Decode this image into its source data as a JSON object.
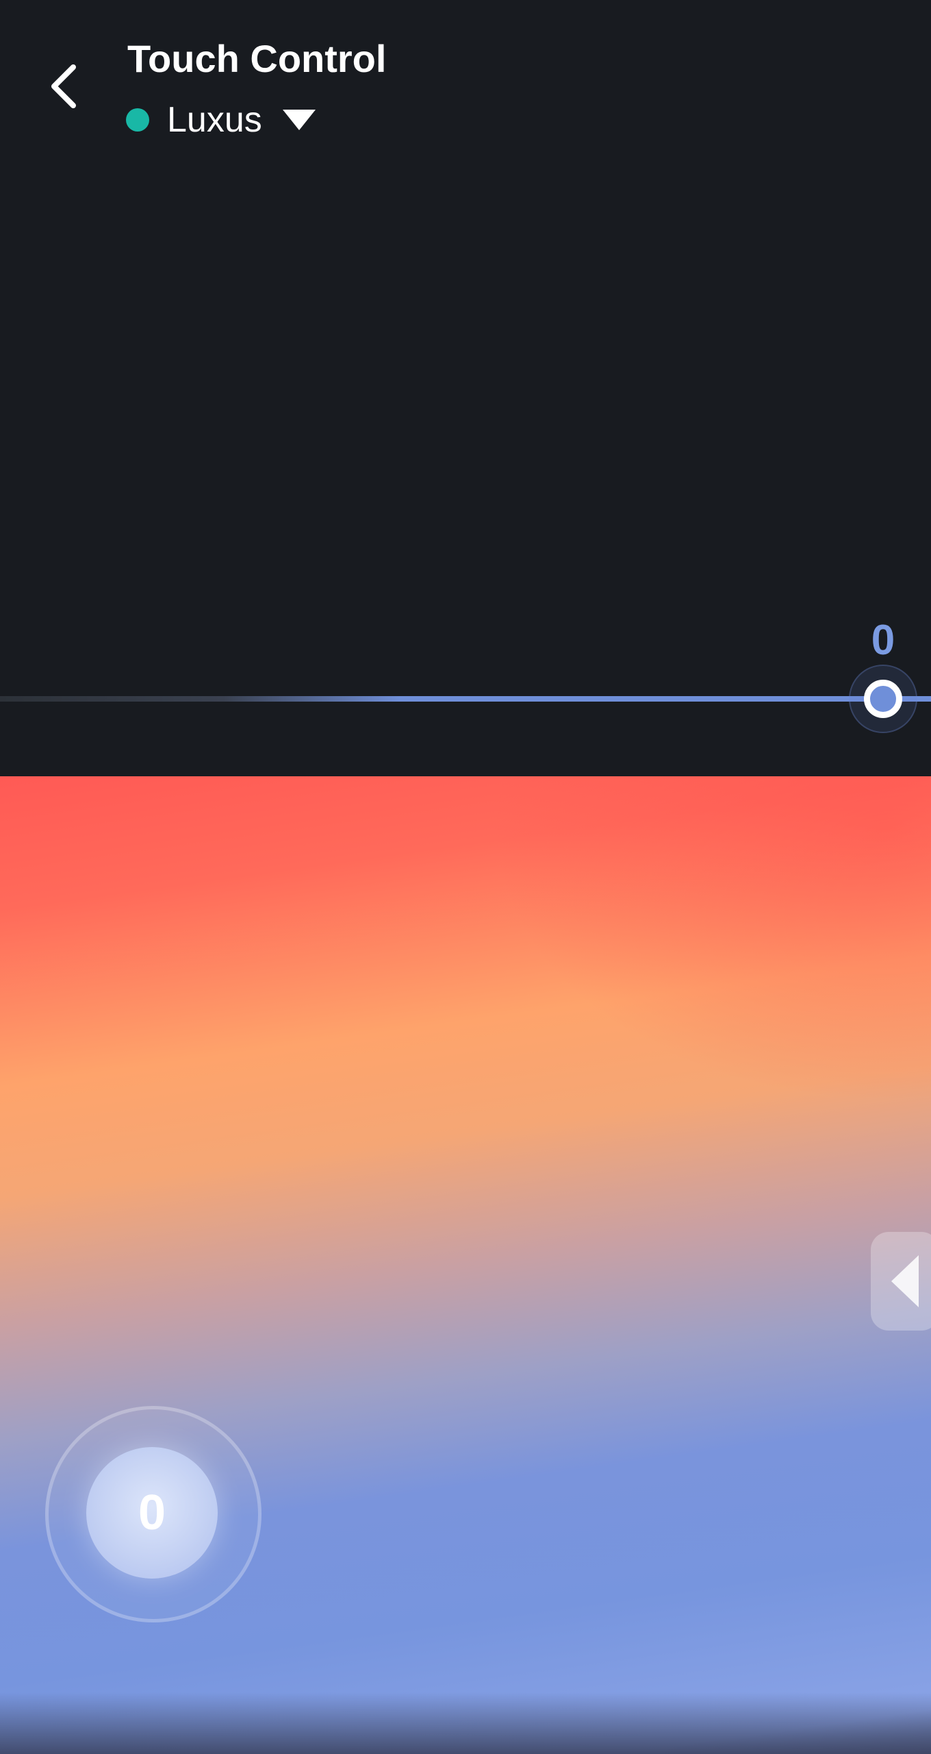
{
  "header": {
    "title": "Touch Control",
    "back_icon": "chevron-left-icon",
    "device": {
      "name": "Luxus",
      "status_color": "#19b8a6",
      "dropdown_icon": "triangle-down-icon"
    }
  },
  "intensity_slider": {
    "value": "0",
    "level": 0.95,
    "value_color": "#7b9be2",
    "track_color": "#6f8fd9",
    "thumb_color": "#6f8fd9"
  },
  "touch_pad": {
    "side_panel_icon": "triangle-left-icon",
    "joystick_value": "0"
  },
  "colors": {
    "background": "#181b20",
    "accent": "#6f8fd9",
    "gradient_top": "#ff5a55",
    "gradient_mid": "#fea36b",
    "gradient_bottom": "#7795de"
  }
}
